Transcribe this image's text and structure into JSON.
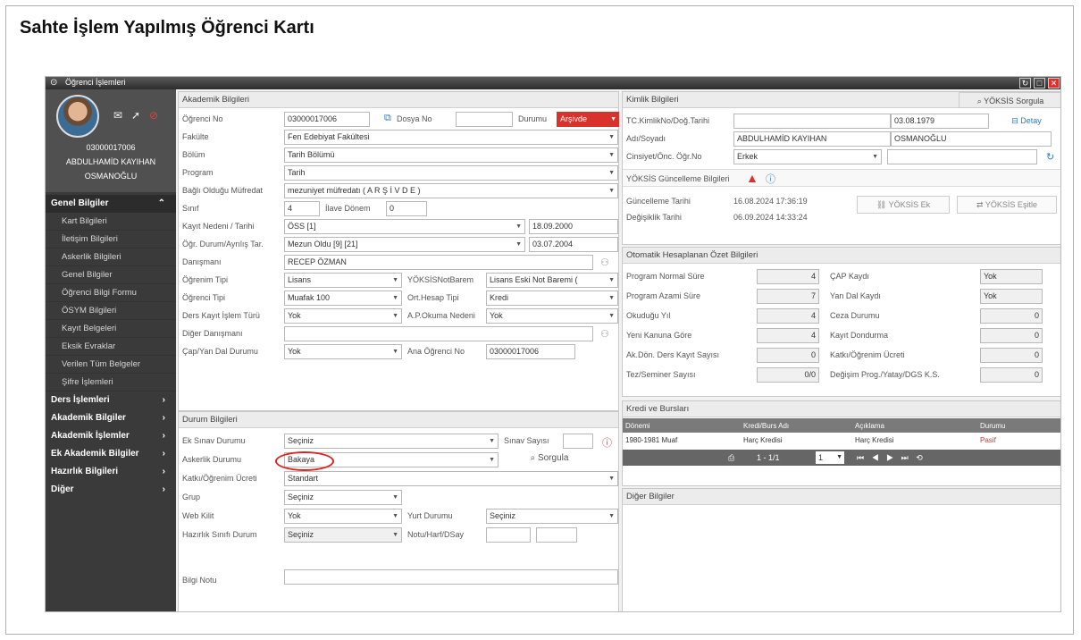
{
  "doc_title": "Sahte İşlem Yapılmış Öğrenci Kartı",
  "window": {
    "title": "Öğrenci İşlemleri"
  },
  "profile": {
    "number": "03000017006",
    "name_line1": "ABDULHAMİD KAYIHAN",
    "name_line2": "OSMANOĞLU"
  },
  "sidebar": {
    "genel": "Genel Bilgiler",
    "sub_items": [
      "Kart Bilgileri",
      "İletişim Bilgileri",
      "Askerlik Bilgileri",
      "Genel Bilgiler",
      "Öğrenci Bilgi Formu",
      "ÖSYM Bilgileri",
      "Kayıt Belgeleri",
      "Eksik Evraklar",
      "Verilen Tüm Belgeler",
      "Şifre İşlemleri"
    ],
    "main_items": [
      "Ders İşlemleri",
      "Akademik Bilgiler",
      "Akademik İşlemler",
      "Ek Akademik Bilgiler",
      "Hazırlık Bilgileri",
      "Diğer"
    ]
  },
  "akademik": {
    "title": "Akademik Bilgileri",
    "ogrenci_no_label": "Öğrenci No",
    "ogrenci_no": "03000017006",
    "dosya_no_label": "Dosya No",
    "durumu_label": "Durumu",
    "durumu": "Arşivde",
    "fakulte_label": "Fakülte",
    "fakulte": "Fen Edebiyat Fakültesi",
    "bolum_label": "Bölüm",
    "bolum": "Tarih Bölümü",
    "program_label": "Program",
    "program": "Tarih",
    "mufredat_label": "Bağlı Olduğu Müfredat",
    "mufredat": "mezuniyet müfredatı ( A R Ş İ V D E )",
    "sinif_label": "Sınıf",
    "sinif": "4",
    "ilave_label": "İlave Dönem",
    "ilave": "0",
    "kayit_label": "Kayıt Nedeni / Tarihi",
    "kayit": "ÖSS [1]",
    "kayit_tarih": "18.09.2000",
    "ayrilis_label": "Öğr. Durum/Ayrılış Tar.",
    "ayrilis": "Mezun Oldu [9] [21]",
    "ayrilis_tarih": "03.07.2004",
    "danisman_label": "Danışmanı",
    "danisman": "RECEP ÖZMAN",
    "ogrenim_tipi_label": "Öğrenim Tipi",
    "ogrenim_tipi": "Lisans",
    "notbarem_label": "YÖKSİSNotBarem",
    "notbarem": "Lisans Eski Not Baremi (",
    "ogrenci_tipi_label": "Öğrenci Tipi",
    "ogrenci_tipi": "Muafak 100",
    "ort_label": "Ort.Hesap Tipi",
    "ort": "Kredi",
    "ders_kayit_label": "Ders Kayıt İşlem Türü",
    "ders_kayit": "Yok",
    "ap_label": "A.P.Okuma Nedeni",
    "ap": "Yok",
    "diger_dan_label": "Diğer Danışmanı",
    "cap_label": "Çap/Yan Dal Durumu",
    "cap": "Yok",
    "ana_no_label": "Ana Öğrenci No",
    "ana_no": "03000017006"
  },
  "durum": {
    "title": "Durum Bilgileri",
    "ek_sinav_label": "Ek Sınav Durumu",
    "ek_sinav": "Seçiniz",
    "sinav_sayisi_label": "Sınav Sayısı",
    "askerlik_label": "Askerlik Durumu",
    "askerlik": "Bakaya",
    "sorgula": "Sorgula",
    "katki_label": "Katkı/Öğrenim Ücreti",
    "katki": "Standart",
    "grup_label": "Grup",
    "grup": "Seçiniz",
    "webkilit_label": "Web Kilit",
    "webkilit": "Yok",
    "yurt_label": "Yurt Durumu",
    "yurt": "Seçiniz",
    "hazirlik_label": "Hazırlık Sınıfı Durum",
    "hazirlik": "Seçiniz",
    "notu_label": "Notu/Harf/DSay",
    "bilgi_label": "Bilgi Notu"
  },
  "kimlik": {
    "title": "Kimlik Bilgileri",
    "yoksis_sorgula": "YÖKSİS Sorgula",
    "tc_label": "TC.KimlikNo/Doğ.Tarihi",
    "dogum": "03.08.1979",
    "detay": "Detay",
    "adsoyad_label": "Adı/Soyadı",
    "ad": "ABDULHAMİD KAYIHAN",
    "soyad": "OSMANOĞLU",
    "cinsiyet_label": "Cinsiyet/Önc. Öğr.No",
    "cinsiyet": "Erkek",
    "yoksis_guncel": "YÖKSİS Güncelleme Bilgileri",
    "guncelleme_label": "Güncelleme Tarihi",
    "guncelleme": "16.08.2024 17:36:19",
    "degisiklik_label": "Değişiklik Tarihi",
    "degisiklik": "06.09.2024 14:33:24",
    "yoksis_ek": "YÖKSİS Ek",
    "yoksis_esitle": "YÖKSİS Eşitle"
  },
  "ozet": {
    "title": "Otomatik Hesaplanan Özet Bilgileri",
    "left": [
      [
        "Program Normal Süre",
        "4"
      ],
      [
        "Program Azami Süre",
        "7"
      ],
      [
        "Okuduğu Yıl",
        "4"
      ],
      [
        "Yeni Kanuna Göre",
        "4"
      ],
      [
        "Ak.Dön. Ders Kayıt Sayısı",
        "0"
      ],
      [
        "Tez/Seminer Sayısı",
        "0/0"
      ]
    ],
    "right": [
      [
        "ÇAP Kaydı",
        "Yok"
      ],
      [
        "Yan Dal Kaydı",
        "Yok"
      ],
      [
        "Ceza Durumu",
        "0"
      ],
      [
        "Kayıt Dondurma",
        "0"
      ],
      [
        "Katkı/Öğrenim Ücreti",
        "0"
      ],
      [
        "Değişim Prog./Yatay/DGS K.S.",
        "0"
      ]
    ]
  },
  "kredi": {
    "title": "Kredi ve Bursları",
    "headers": [
      "Dönemi",
      "Kredi/Burs Adı",
      "Açıklama",
      "Durumu"
    ],
    "row": [
      "1980-1981 Muaf",
      "Harç Kredisi",
      "Harç Kredisi",
      "Pasif"
    ],
    "pager": "1 - 1/1",
    "page": "1"
  },
  "diger": {
    "title": "Diğer Bilgiler"
  }
}
